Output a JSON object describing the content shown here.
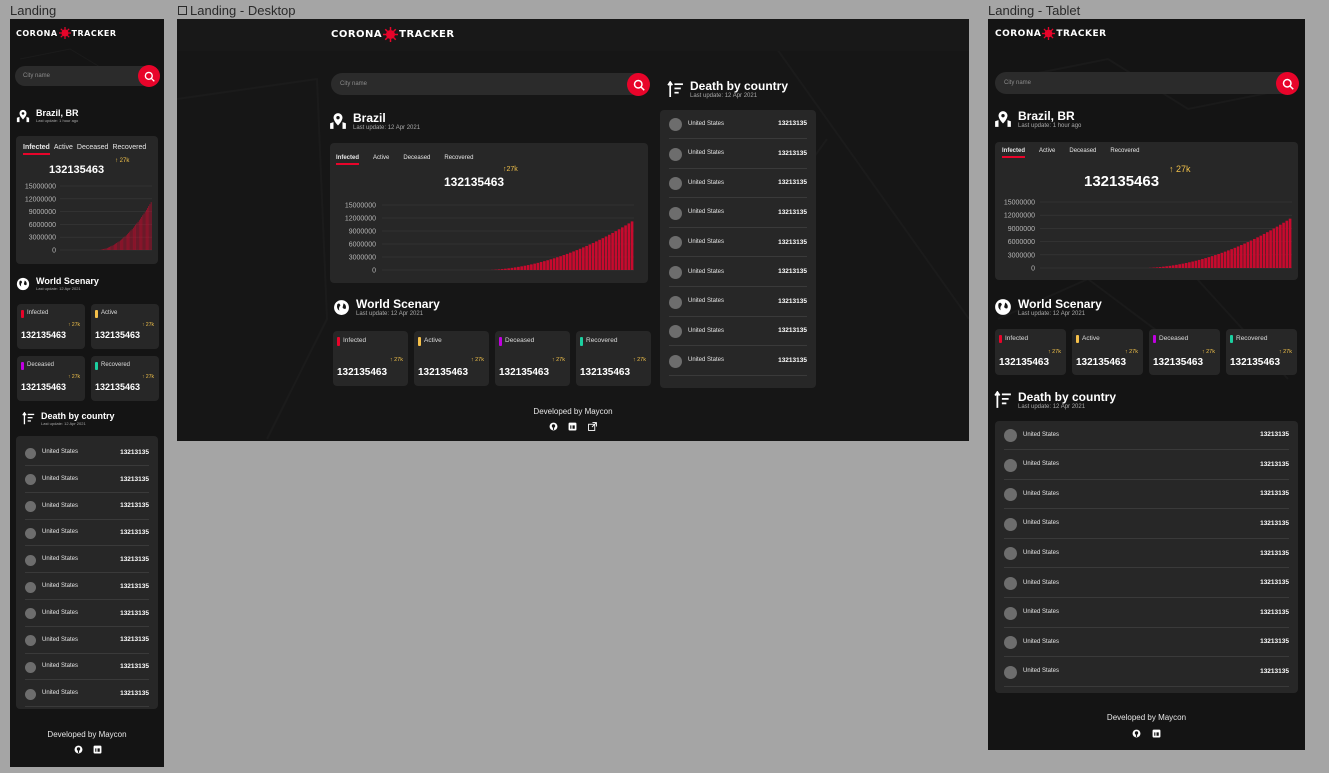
{
  "frames": {
    "mobile_label": "Landing",
    "desktop_label": "Landing - Desktop",
    "tablet_label": "Landing - Tablet"
  },
  "logo": {
    "left": "CORONA",
    "right": "TRACKER"
  },
  "search": {
    "placeholder": "City name"
  },
  "country": {
    "title": "Brazil",
    "title_mobile": "Brazil, BR",
    "update_desktop": "Last update: 12 Apr 2021",
    "update_short": "Last update: 1 hour ago"
  },
  "tabs": [
    "Infected",
    "Active",
    "Deceased",
    "Recovered"
  ],
  "chart_data": {
    "type": "bar",
    "series_name": "Infected",
    "total": "132135463",
    "growth": "27k",
    "y_ticks": [
      "15000000",
      "12000000",
      "9000000",
      "6000000",
      "3000000",
      "0"
    ],
    "ylim": [
      0,
      15000000
    ],
    "values": [
      0,
      40000,
      90000,
      150000,
      220000,
      300000,
      390000,
      490000,
      600000,
      720000,
      850000,
      990000,
      1140000,
      1300000,
      1470000,
      1650000,
      1840000,
      2040000,
      2250000,
      2470000,
      2700000,
      2940000,
      3190000,
      3450000,
      3720000,
      4000000,
      4290000,
      4590000,
      4900000,
      5220000,
      5550000,
      5890000,
      6240000,
      6600000,
      6970000,
      7350000,
      7740000,
      8140000,
      8550000,
      8970000,
      9400000,
      9840000,
      10290000,
      10750000,
      11220000
    ]
  },
  "world": {
    "title": "World Scenary",
    "update": "Last update: 12 Apr 2021",
    "stats": [
      {
        "label": "Infected",
        "value": "132135463",
        "growth": "27k",
        "color": "#e8042a"
      },
      {
        "label": "Active",
        "value": "132135463",
        "growth": "27k",
        "color": "#f5c04a"
      },
      {
        "label": "Deceased",
        "value": "132135463",
        "growth": "27k",
        "color": "#c000e0"
      },
      {
        "label": "Recovered",
        "value": "132135463",
        "growth": "27k",
        "color": "#1ccfa0"
      }
    ]
  },
  "deaths": {
    "title": "Death by country",
    "update": "Last update: 12 Apr 2021",
    "rows": [
      {
        "country": "United States",
        "value": "13213135"
      },
      {
        "country": "United States",
        "value": "13213135"
      },
      {
        "country": "United States",
        "value": "13213135"
      },
      {
        "country": "United States",
        "value": "13213135"
      },
      {
        "country": "United States",
        "value": "13213135"
      },
      {
        "country": "United States",
        "value": "13213135"
      },
      {
        "country": "United States",
        "value": "13213135"
      },
      {
        "country": "United States",
        "value": "13213135"
      },
      {
        "country": "United States",
        "value": "13213135"
      },
      {
        "country": "United States",
        "value": "13213135"
      }
    ]
  },
  "footer": {
    "text": "Developed by Maycon",
    "icons": [
      "github-icon",
      "linkedin-icon",
      "external-link-icon"
    ]
  },
  "colors": {
    "accent": "#e8042a",
    "bg": "#141414",
    "card": "#272727",
    "growth": "#f0c04a"
  }
}
